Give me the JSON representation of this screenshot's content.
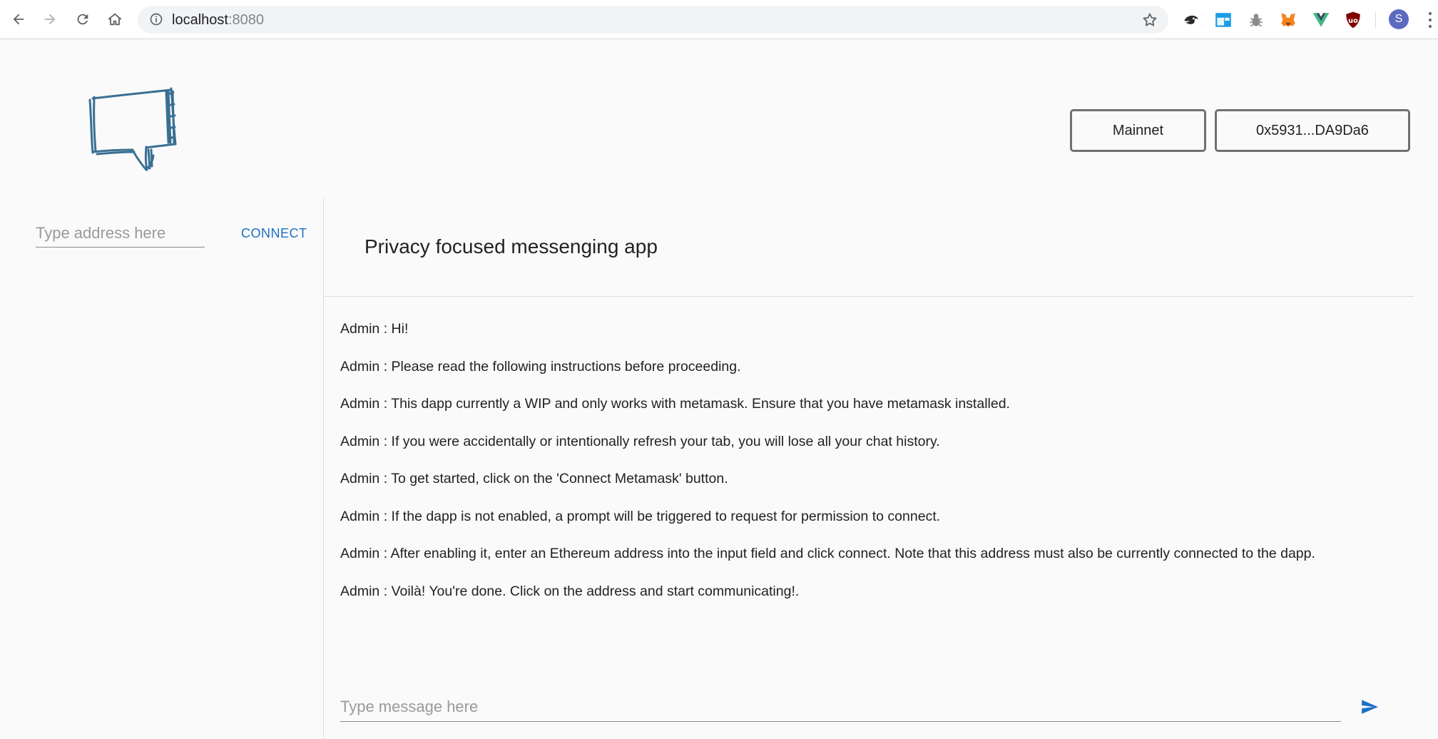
{
  "browser": {
    "url_host": "localhost",
    "url_port": ":8080",
    "profile_initial": "S",
    "icons": {
      "back": "arrow-left-icon",
      "forward": "arrow-right-icon",
      "reload": "reload-icon",
      "home": "home-icon",
      "info": "info-icon",
      "bookmark": "star-icon"
    },
    "extensions": [
      "orca-extension-icon",
      "window-extension-icon",
      "bug-extension-icon",
      "metamask-fox-icon",
      "vue-devtools-icon",
      "ublock-origin-icon"
    ]
  },
  "header": {
    "logo": "speech-bubble-logo",
    "network_label": "Mainnet",
    "account_label": "0x5931...DA9Da6"
  },
  "sidebar": {
    "address_placeholder": "Type address here",
    "connect_label": "CONNECT"
  },
  "chat": {
    "title": "Privacy focused messenging app",
    "messages": [
      {
        "sender": "Admin",
        "text": "Hi!"
      },
      {
        "sender": "Admin",
        "text": "Please read the following instructions before proceeding."
      },
      {
        "sender": "Admin",
        "text": "This dapp currently a WIP and only works with metamask. Ensure that you have metamask installed."
      },
      {
        "sender": "Admin",
        "text": "If you were accidentally or intentionally refresh your tab, you will lose all your chat history."
      },
      {
        "sender": "Admin",
        "text": "To get started, click on the 'Connect Metamask' button."
      },
      {
        "sender": "Admin",
        "text": "If the dapp is not enabled, a prompt will be triggered to request for permission to connect."
      },
      {
        "sender": "Admin",
        "text": "After enabling it, enter an Ethereum address into the input field and click connect. Note that this address must also be currently connected to the dapp."
      },
      {
        "sender": "Admin",
        "text": "Voilà! You're done. Click on the address and start communicating!."
      }
    ],
    "message_placeholder": "Type message here",
    "send_icon": "send-icon"
  },
  "colors": {
    "accent": "#1e6fc4",
    "background": "#fafafa",
    "border": "#707070",
    "logo_stroke": "#3a6f93"
  }
}
